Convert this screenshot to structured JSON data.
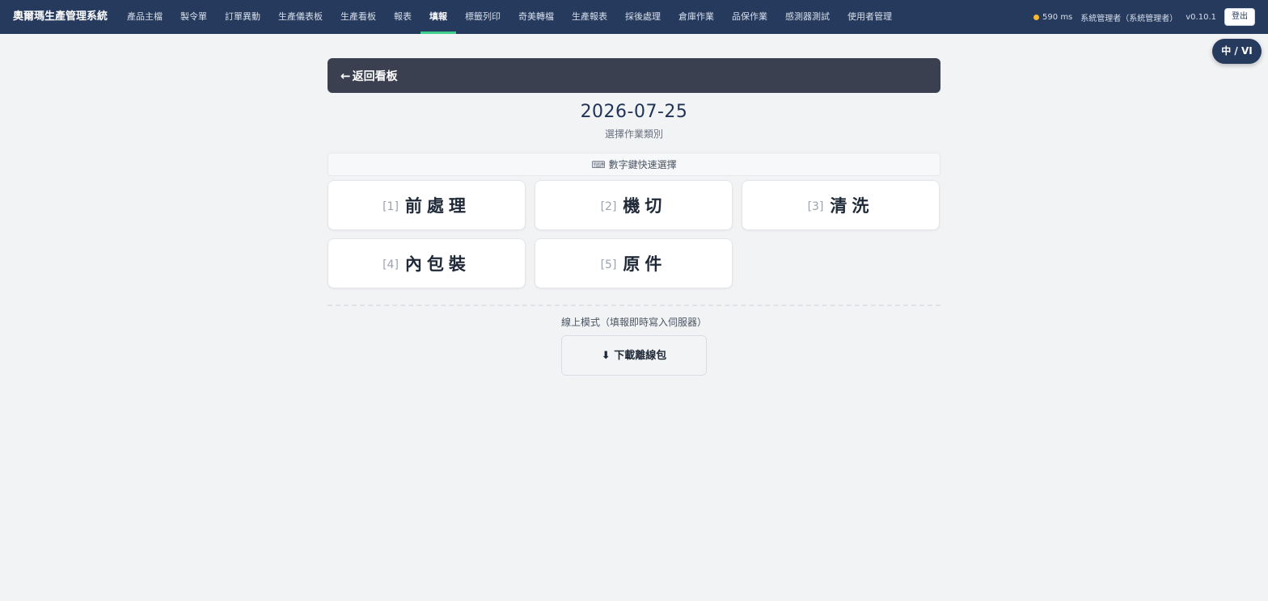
{
  "app": {
    "title": "奧爾瑪生產管理系統"
  },
  "nav": {
    "items": [
      {
        "label": "產品主檔"
      },
      {
        "label": "製令單"
      },
      {
        "label": "訂單異動"
      },
      {
        "label": "生產儀表板"
      },
      {
        "label": "生產看板"
      },
      {
        "label": "報表"
      },
      {
        "label": "填報",
        "active": true
      },
      {
        "label": "標籤列印"
      },
      {
        "label": "奇美轉檔"
      },
      {
        "label": "生產報表"
      },
      {
        "label": "採後處理"
      },
      {
        "label": "倉庫作業"
      },
      {
        "label": "品保作業"
      },
      {
        "label": "感測器測試"
      },
      {
        "label": "使用者管理"
      }
    ]
  },
  "status": {
    "latency": "590 ms",
    "latency_color": "#f5b82e",
    "user": "系統管理者（系統管理者）",
    "version": "v0.10.1",
    "logout_label": "登出"
  },
  "lang_toggle": "中 / VI",
  "back": {
    "arrow_icon": "arrow-left-icon",
    "label": "返回看板"
  },
  "date": "2026-07-25",
  "subtitle": "選擇作業類別",
  "hint": {
    "icon": "keyboard-icon",
    "text": "數字鍵快速選擇"
  },
  "categories": [
    {
      "num": "[1]",
      "label": "前處理"
    },
    {
      "num": "[2]",
      "label": "機切"
    },
    {
      "num": "[3]",
      "label": "清洗"
    },
    {
      "num": "[4]",
      "label": "內包裝"
    },
    {
      "num": "[5]",
      "label": "原件"
    }
  ],
  "mode_text": "線上模式（填報即時寫入伺服器）",
  "download": {
    "icon": "download-icon",
    "label": "下載離線包"
  },
  "colors": {
    "header": "#263a5e",
    "active_tab": "#3ecf8e",
    "back_bar": "#3a404f"
  }
}
